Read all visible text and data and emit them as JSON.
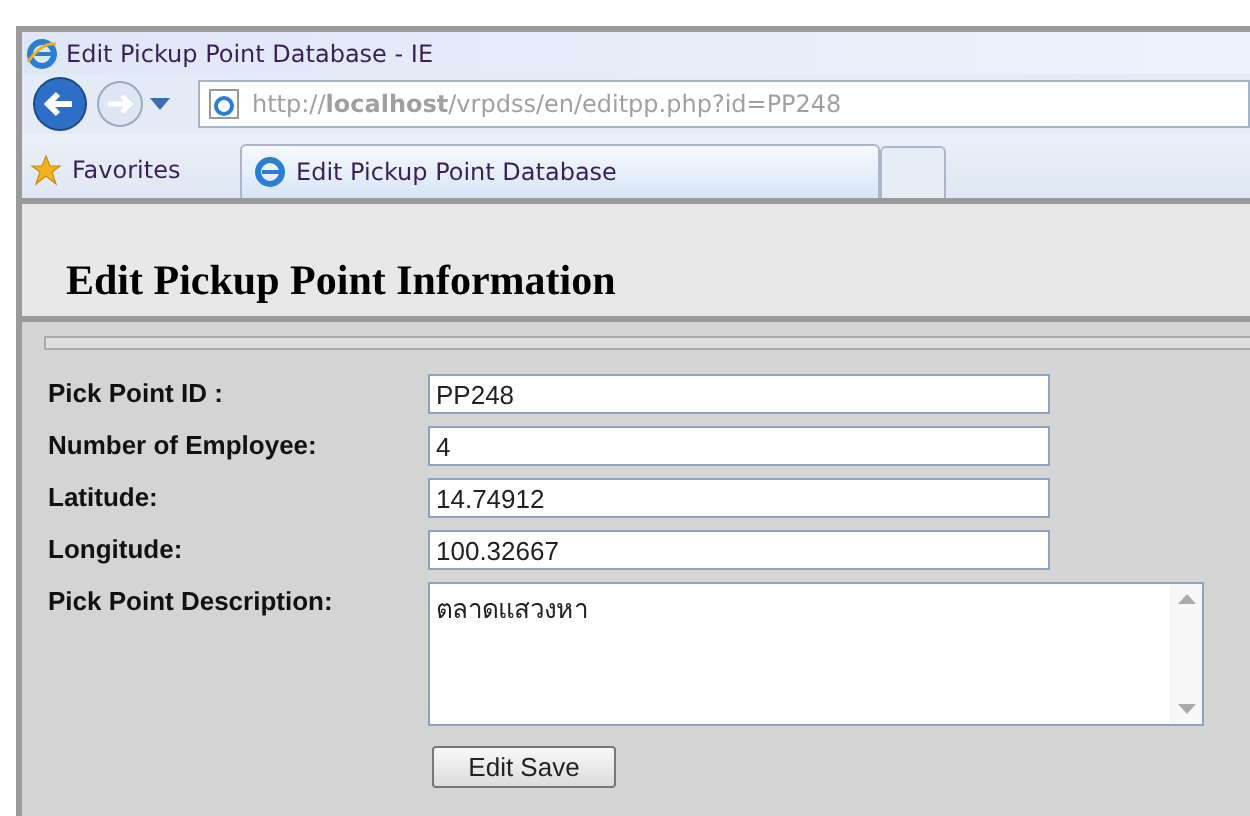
{
  "window": {
    "title": "Edit Pickup Point Database - IE"
  },
  "address_bar": {
    "url": "http://**localhost**/vrpdss/en/editpp.php?id=PP248"
  },
  "favorites": {
    "label": "Favorites"
  },
  "tabs": [
    {
      "kind": "page",
      "label": "Edit Pickup Point Database",
      "selected": true
    },
    {
      "kind": "new",
      "selected": false
    }
  ],
  "page": {
    "heading": "Edit Pickup Point Information"
  },
  "form": {
    "fields": [
      {
        "kind": "input",
        "label": "Pick Point ID :",
        "value": "PP248"
      },
      {
        "kind": "input",
        "label": "Number of Employee:",
        "value": "4"
      },
      {
        "kind": "input",
        "label": "Latitude:",
        "value": "14.74912"
      },
      {
        "kind": "input",
        "label": "Longitude:",
        "value": "100.32667"
      },
      {
        "kind": "textarea",
        "label": "Pick Point Description:",
        "value": "ตลาดแสวงหา"
      }
    ],
    "submit": "Edit Save"
  }
}
